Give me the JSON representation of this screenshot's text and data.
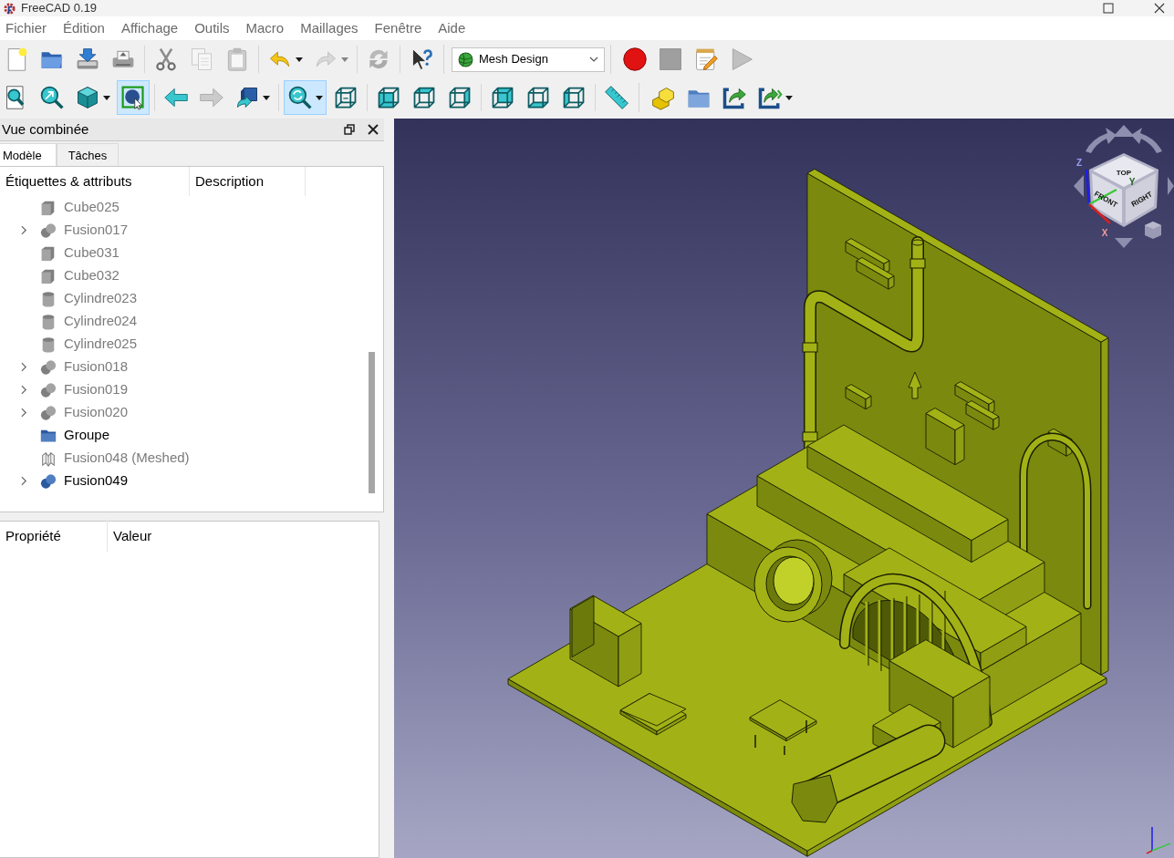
{
  "window": {
    "title": "FreeCAD 0.19"
  },
  "menu": [
    "Fichier",
    "Édition",
    "Affichage",
    "Outils",
    "Macro",
    "Maillages",
    "Fenêtre",
    "Aide"
  ],
  "toolbar_rows": [
    {
      "toolbars": [
        {
          "items": [
            {
              "kind": "new",
              "active": false,
              "disabled": false,
              "has_menu": false
            },
            {
              "kind": "open",
              "active": false,
              "disabled": false,
              "has_menu": false
            },
            {
              "kind": "save",
              "active": false,
              "disabled": false,
              "has_menu": false
            },
            {
              "kind": "print",
              "active": false,
              "disabled": false,
              "has_menu": false
            },
            {
              "kind": "separator"
            },
            {
              "kind": "cut",
              "active": false,
              "disabled": false,
              "has_menu": false
            },
            {
              "kind": "copy",
              "active": false,
              "disabled": true,
              "has_menu": false
            },
            {
              "kind": "paste",
              "active": false,
              "disabled": true,
              "has_menu": false
            },
            {
              "kind": "separator"
            },
            {
              "kind": "undo",
              "active": false,
              "disabled": false,
              "has_menu": true
            },
            {
              "kind": "redo",
              "active": false,
              "disabled": true,
              "has_menu": true
            },
            {
              "kind": "separator"
            },
            {
              "kind": "refresh",
              "active": false,
              "disabled": true,
              "has_menu": false
            },
            {
              "kind": "separator"
            },
            {
              "kind": "whats-this",
              "active": false,
              "disabled": false,
              "has_menu": false
            }
          ]
        },
        {
          "items": [
            {
              "kind": "workbench",
              "label": "Mesh Design"
            }
          ]
        },
        {
          "items": [
            {
              "kind": "record",
              "active": false,
              "disabled": false,
              "has_menu": false
            },
            {
              "kind": "stop",
              "active": false,
              "disabled": true,
              "has_menu": false
            },
            {
              "kind": "edit-macro",
              "active": false,
              "disabled": false,
              "has_menu": false
            },
            {
              "kind": "play",
              "active": false,
              "disabled": true,
              "has_menu": false
            }
          ]
        }
      ]
    },
    {
      "toolbars": [
        {
          "items": [
            {
              "kind": "fit-all",
              "active": false,
              "disabled": false,
              "has_menu": false
            },
            {
              "kind": "fit-selection",
              "active": false,
              "disabled": false,
              "has_menu": false
            },
            {
              "kind": "draw-style",
              "active": false,
              "disabled": false,
              "has_menu": true
            },
            {
              "kind": "bounding-box",
              "active": true,
              "disabled": false,
              "has_menu": false
            },
            {
              "kind": "separator"
            },
            {
              "kind": "back",
              "active": false,
              "disabled": false,
              "has_menu": false
            },
            {
              "kind": "forward",
              "active": false,
              "disabled": true,
              "has_menu": false
            },
            {
              "kind": "set-view",
              "active": false,
              "disabled": false,
              "has_menu": true
            },
            {
              "kind": "separator"
            },
            {
              "kind": "sync-zoom",
              "active": true,
              "disabled": false,
              "has_menu": true
            },
            {
              "kind": "axonometric",
              "active": false,
              "disabled": false,
              "has_menu": false
            },
            {
              "kind": "separator"
            },
            {
              "kind": "front",
              "active": false,
              "disabled": false,
              "has_menu": false
            },
            {
              "kind": "top",
              "active": false,
              "disabled": false,
              "has_menu": false
            },
            {
              "kind": "right",
              "active": false,
              "disabled": false,
              "has_menu": false
            },
            {
              "kind": "separator"
            },
            {
              "kind": "rear",
              "active": false,
              "disabled": false,
              "has_menu": false
            },
            {
              "kind": "bottom",
              "active": false,
              "disabled": false,
              "has_menu": false
            },
            {
              "kind": "left",
              "active": false,
              "disabled": false,
              "has_menu": false
            },
            {
              "kind": "separator"
            },
            {
              "kind": "measure",
              "active": false,
              "disabled": false,
              "has_menu": false
            }
          ]
        },
        {
          "items": [
            {
              "kind": "part",
              "active": false,
              "disabled": false,
              "has_menu": false
            },
            {
              "kind": "group",
              "active": false,
              "disabled": false,
              "has_menu": false
            },
            {
              "kind": "link",
              "active": false,
              "disabled": false,
              "has_menu": false
            },
            {
              "kind": "link-actions",
              "active": false,
              "disabled": false,
              "has_menu": true
            }
          ]
        }
      ]
    }
  ],
  "combo_view": {
    "title": "Vue combinée",
    "tabs": [
      {
        "label": "Modèle",
        "selected": true
      },
      {
        "label": "Tâches",
        "selected": false
      }
    ],
    "tree": {
      "columns": [
        "Étiquettes & attributs",
        "Description"
      ],
      "items": [
        {
          "label": "Cube025",
          "kind": "cube",
          "hidden": true,
          "expandable": false
        },
        {
          "label": "Fusion017",
          "kind": "fusion",
          "hidden": true,
          "expandable": true
        },
        {
          "label": "Cube031",
          "kind": "cube",
          "hidden": true,
          "expandable": false
        },
        {
          "label": "Cube032",
          "kind": "cube",
          "hidden": true,
          "expandable": false
        },
        {
          "label": "Cylindre023",
          "kind": "cylinder",
          "hidden": true,
          "expandable": false
        },
        {
          "label": "Cylindre024",
          "kind": "cylinder",
          "hidden": true,
          "expandable": false
        },
        {
          "label": "Cylindre025",
          "kind": "cylinder",
          "hidden": true,
          "expandable": false
        },
        {
          "label": "Fusion018",
          "kind": "fusion",
          "hidden": true,
          "expandable": true
        },
        {
          "label": "Fusion019",
          "kind": "fusion",
          "hidden": true,
          "expandable": true
        },
        {
          "label": "Fusion020",
          "kind": "fusion",
          "hidden": true,
          "expandable": true
        },
        {
          "label": "Groupe",
          "kind": "folder",
          "hidden": false,
          "expandable": false
        },
        {
          "label": "Fusion048 (Meshed)",
          "kind": "mesh",
          "hidden": true,
          "expandable": false
        },
        {
          "label": "Fusion049",
          "kind": "fusion",
          "hidden": false,
          "expandable": true
        }
      ]
    },
    "properties": {
      "columns": [
        "Propriété",
        "Valeur"
      ]
    }
  },
  "view_3d": {
    "nav_cube": {
      "faces": [
        {
          "kind": "top",
          "label": "TOP"
        },
        {
          "kind": "front",
          "label": "FRONT"
        },
        {
          "kind": "right",
          "label": "RIGHT"
        }
      ],
      "axes": [
        {
          "kind": "z",
          "label": "Z",
          "color": "#1e1ee6"
        },
        {
          "kind": "y",
          "label": "Y",
          "color": "#3cc83c"
        },
        {
          "kind": "x",
          "label": "X",
          "color": "#d42020"
        }
      ]
    }
  }
}
